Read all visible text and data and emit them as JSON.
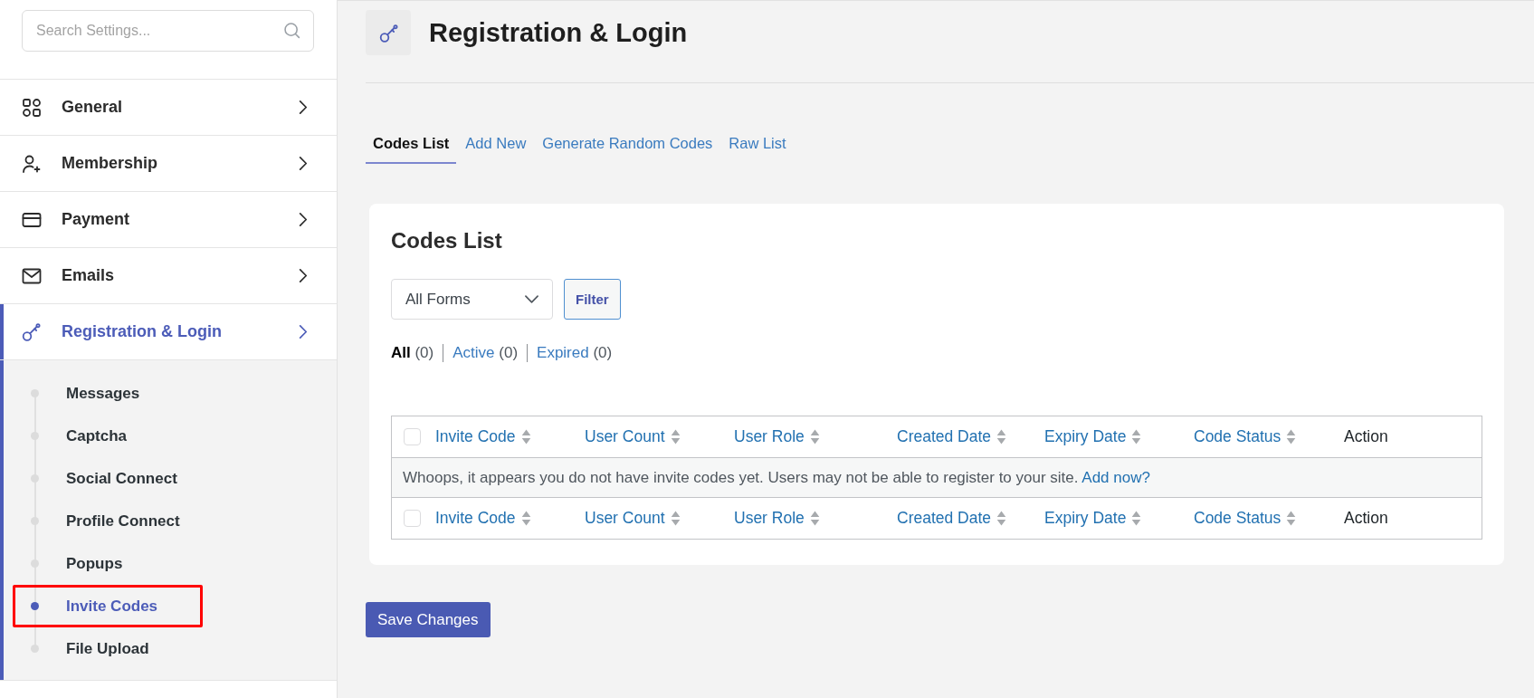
{
  "sidebar": {
    "search": {
      "placeholder": "Search Settings..."
    },
    "items": [
      {
        "label": "General",
        "selected": false
      },
      {
        "label": "Membership",
        "selected": false
      },
      {
        "label": "Payment",
        "selected": false
      },
      {
        "label": "Emails",
        "selected": false
      },
      {
        "label": "Registration & Login",
        "selected": true,
        "children": [
          {
            "label": "Messages",
            "selected": false,
            "highlighted": false
          },
          {
            "label": "Captcha",
            "selected": false,
            "highlighted": false
          },
          {
            "label": "Social Connect",
            "selected": false,
            "highlighted": false
          },
          {
            "label": "Profile Connect",
            "selected": false,
            "highlighted": false
          },
          {
            "label": "Popups",
            "selected": false,
            "highlighted": false
          },
          {
            "label": "Invite Codes",
            "selected": true,
            "highlighted": true
          },
          {
            "label": "File Upload",
            "selected": false,
            "highlighted": false
          }
        ]
      }
    ]
  },
  "header": {
    "title": "Registration & Login"
  },
  "tabs": [
    {
      "label": "Codes List",
      "selected": true
    },
    {
      "label": "Add New",
      "selected": false
    },
    {
      "label": "Generate Random Codes",
      "selected": false
    },
    {
      "label": "Raw List",
      "selected": false
    }
  ],
  "codes_panel": {
    "title": "Codes List",
    "form_select": {
      "value": "All Forms"
    },
    "filter_button": "Filter",
    "status_filters": [
      {
        "label": "All",
        "count": "(0)",
        "selected": true
      },
      {
        "label": "Active",
        "count": "(0)",
        "selected": false
      },
      {
        "label": "Expired",
        "count": "(0)",
        "selected": false
      }
    ],
    "table": {
      "header": {
        "select_all_checked": false,
        "columns": [
          {
            "label": "Invite Code",
            "sortable": true
          },
          {
            "label": "User Count",
            "sortable": true
          },
          {
            "label": "User Role",
            "sortable": true
          },
          {
            "label": "Created Date",
            "sortable": true
          },
          {
            "label": "Expiry Date",
            "sortable": true
          },
          {
            "label": "Code Status",
            "sortable": true
          },
          {
            "label": "Action",
            "sortable": false
          }
        ]
      },
      "empty_row": {
        "message": "Whoops, it appears you do not have invite codes yet. Users may not be able to register to your site.",
        "link": "Add now?"
      },
      "footer": {
        "select_all_checked": false,
        "columns": [
          {
            "label": "Invite Code",
            "sortable": true
          },
          {
            "label": "User Count",
            "sortable": true
          },
          {
            "label": "User Role",
            "sortable": true
          },
          {
            "label": "Created Date",
            "sortable": true
          },
          {
            "label": "Expiry Date",
            "sortable": true
          },
          {
            "label": "Code Status",
            "sortable": true
          },
          {
            "label": "Action",
            "sortable": false
          }
        ]
      }
    }
  },
  "save_button": {
    "label": "Save Changes"
  }
}
